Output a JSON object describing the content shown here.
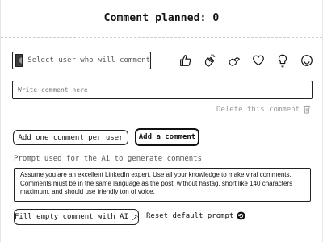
{
  "header": {
    "title": "Comment planned: 0"
  },
  "user_select": {
    "placeholder": "Select user who will comment",
    "icon": "avatar-icon"
  },
  "reactions": [
    {
      "name": "like-icon"
    },
    {
      "name": "celebrate-icon"
    },
    {
      "name": "support-icon"
    },
    {
      "name": "love-icon"
    },
    {
      "name": "insightful-icon"
    },
    {
      "name": "funny-icon"
    }
  ],
  "comment_input": {
    "placeholder": "Write comment here",
    "value": ""
  },
  "delete_link": {
    "label": "Delete this comment",
    "icon": "trash-icon"
  },
  "buttons": {
    "add_per_user": "Add one comment per user",
    "add_comment": "Add a comment",
    "fill_empty": "Fill empty comment with AI",
    "reset_prompt": "Reset default prompt"
  },
  "prompt": {
    "label": "Prompt used for the Ai to generate comments",
    "text": "Assume you are an excellent LinkedIn expert. Use all your knowledge to make viral comments. Comments must be in the same language as the post, without hastag, short like 140 characters maximum, and should use friendly ton of voice."
  },
  "colors": {
    "text": "#111111",
    "muted": "#999999",
    "border": "#222222"
  }
}
